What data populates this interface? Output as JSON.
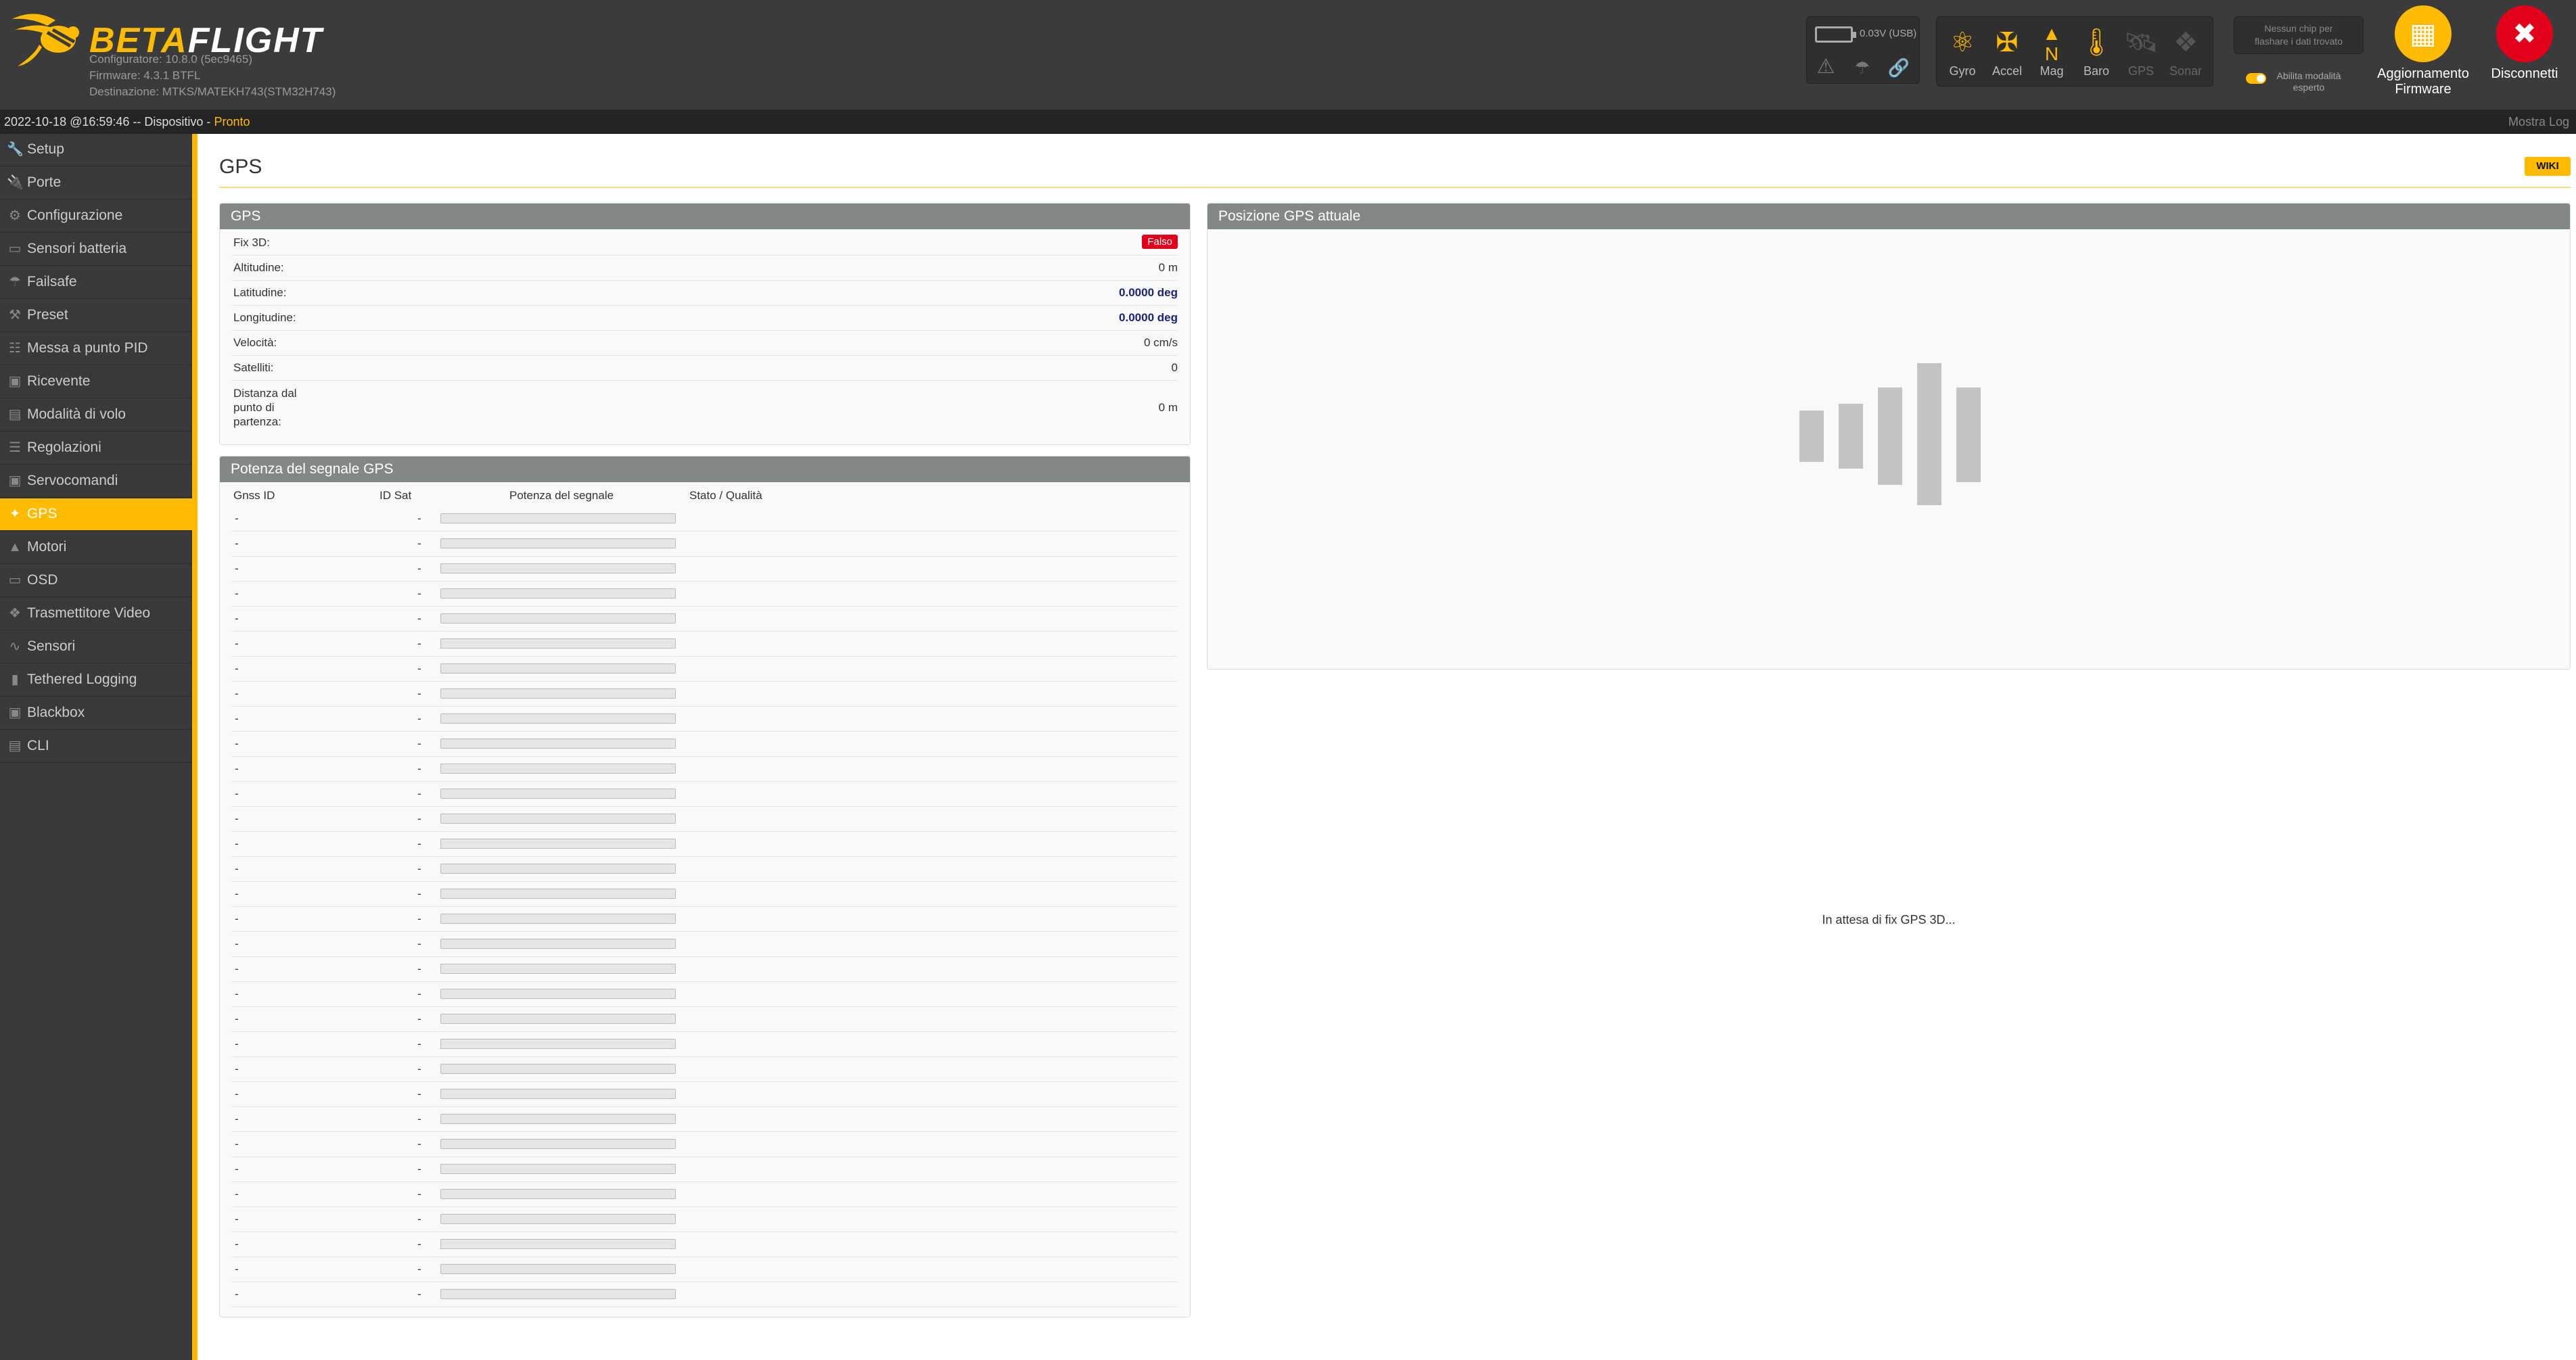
{
  "header": {
    "brand_a": "BETA",
    "brand_b": "FLIGHT",
    "configurator_version": "Configuratore: 10.8.0 (5ec9465)",
    "firmware_version": "Firmware: 4.3.1 BTFL",
    "target": "Destinazione: MTKS/MATEKH743(STM32H743)",
    "battery_text": "0.03V (USB)",
    "sensors": [
      {
        "label": "Gyro",
        "icon": "gyro-icon",
        "active": true
      },
      {
        "label": "Accel",
        "icon": "accel-icon",
        "active": true
      },
      {
        "label": "Mag",
        "icon": "mag-icon",
        "active": true
      },
      {
        "label": "Baro",
        "icon": "baro-icon",
        "active": true
      },
      {
        "label": "GPS",
        "icon": "gps-icon",
        "active": false
      },
      {
        "label": "Sonar",
        "icon": "sonar-icon",
        "active": false
      }
    ],
    "chip_text_line1": "Nessun chip per",
    "chip_text_line2": "flashare i dati trovato",
    "expert_mode_line1": "Abilita modalità",
    "expert_mode_line2": "esperto",
    "firmware_button_line1": "Aggiornamento",
    "firmware_button_line2": "Firmware",
    "disconnect_button": "Disconnetti",
    "accent_color": "#ffbb00",
    "disconnect_color": "#e2001a"
  },
  "statusbar": {
    "prefix": "2022-10-18 @16:59:46 -- Dispositivo - ",
    "ready": "Pronto",
    "show_log": "Mostra Log"
  },
  "sidebar": {
    "items": [
      {
        "label": "Setup",
        "icon": "wrench-icon"
      },
      {
        "label": "Porte",
        "icon": "plug-icon"
      },
      {
        "label": "Configurazione",
        "icon": "gear-icon"
      },
      {
        "label": "Sensori batteria",
        "icon": "battery-icon"
      },
      {
        "label": "Failsafe",
        "icon": "parachute-icon"
      },
      {
        "label": "Preset",
        "icon": "preset-icon"
      },
      {
        "label": "Messa a punto PID",
        "icon": "pid-icon"
      },
      {
        "label": "Ricevente",
        "icon": "receiver-icon"
      },
      {
        "label": "Modalità di volo",
        "icon": "modes-icon"
      },
      {
        "label": "Regolazioni",
        "icon": "adjustments-icon"
      },
      {
        "label": "Servocomandi",
        "icon": "servo-icon"
      },
      {
        "label": "GPS",
        "icon": "gps-icon",
        "active": true
      },
      {
        "label": "Motori",
        "icon": "motor-icon"
      },
      {
        "label": "OSD",
        "icon": "osd-icon"
      },
      {
        "label": "Trasmettitore Video",
        "icon": "vtx-icon"
      },
      {
        "label": "Sensori",
        "icon": "sensors-icon"
      },
      {
        "label": "Tethered Logging",
        "icon": "logging-icon"
      },
      {
        "label": "Blackbox",
        "icon": "blackbox-icon"
      },
      {
        "label": "CLI",
        "icon": "cli-icon"
      }
    ]
  },
  "main": {
    "title": "GPS",
    "wiki": "WIKI",
    "gps_box": {
      "title": "GPS",
      "rows": [
        {
          "label": "Fix 3D:",
          "value": "Falso"
        },
        {
          "label": "Altitudine:",
          "value": "0 m"
        },
        {
          "label": "Latitudine:",
          "value": "0.0000 deg"
        },
        {
          "label": "Longitudine:",
          "value": "0.0000 deg"
        },
        {
          "label": "Velocità:",
          "value": "0 cm/s"
        },
        {
          "label": "Satelliti:",
          "value": "0"
        },
        {
          "label": "Distanza dal punto di partenza:",
          "value": "0 m"
        }
      ]
    },
    "signal_box": {
      "title": "Potenza del segnale GPS",
      "headers": [
        "Gnss ID",
        "ID Sat",
        "Potenza del segnale",
        "Stato / Qualità"
      ],
      "rows": [
        {
          "gnss_id": "-",
          "sat_id": "-",
          "strength": 0
        },
        {
          "gnss_id": "-",
          "sat_id": "-",
          "strength": 0
        },
        {
          "gnss_id": "-",
          "sat_id": "-",
          "strength": 0
        },
        {
          "gnss_id": "-",
          "sat_id": "-",
          "strength": 0
        },
        {
          "gnss_id": "-",
          "sat_id": "-",
          "strength": 0
        },
        {
          "gnss_id": "-",
          "sat_id": "-",
          "strength": 0
        },
        {
          "gnss_id": "-",
          "sat_id": "-",
          "strength": 0
        },
        {
          "gnss_id": "-",
          "sat_id": "-",
          "strength": 0
        },
        {
          "gnss_id": "-",
          "sat_id": "-",
          "strength": 0
        },
        {
          "gnss_id": "-",
          "sat_id": "-",
          "strength": 0
        },
        {
          "gnss_id": "-",
          "sat_id": "-",
          "strength": 0
        },
        {
          "gnss_id": "-",
          "sat_id": "-",
          "strength": 0
        },
        {
          "gnss_id": "-",
          "sat_id": "-",
          "strength": 0
        },
        {
          "gnss_id": "-",
          "sat_id": "-",
          "strength": 0
        },
        {
          "gnss_id": "-",
          "sat_id": "-",
          "strength": 0
        },
        {
          "gnss_id": "-",
          "sat_id": "-",
          "strength": 0
        },
        {
          "gnss_id": "-",
          "sat_id": "-",
          "strength": 0
        },
        {
          "gnss_id": "-",
          "sat_id": "-",
          "strength": 0
        },
        {
          "gnss_id": "-",
          "sat_id": "-",
          "strength": 0
        },
        {
          "gnss_id": "-",
          "sat_id": "-",
          "strength": 0
        },
        {
          "gnss_id": "-",
          "sat_id": "-",
          "strength": 0
        },
        {
          "gnss_id": "-",
          "sat_id": "-",
          "strength": 0
        },
        {
          "gnss_id": "-",
          "sat_id": "-",
          "strength": 0
        },
        {
          "gnss_id": "-",
          "sat_id": "-",
          "strength": 0
        },
        {
          "gnss_id": "-",
          "sat_id": "-",
          "strength": 0
        },
        {
          "gnss_id": "-",
          "sat_id": "-",
          "strength": 0
        },
        {
          "gnss_id": "-",
          "sat_id": "-",
          "strength": 0
        },
        {
          "gnss_id": "-",
          "sat_id": "-",
          "strength": 0
        },
        {
          "gnss_id": "-",
          "sat_id": "-",
          "strength": 0
        },
        {
          "gnss_id": "-",
          "sat_id": "-",
          "strength": 0
        },
        {
          "gnss_id": "-",
          "sat_id": "-",
          "strength": 0
        },
        {
          "gnss_id": "-",
          "sat_id": "-",
          "strength": 0
        }
      ]
    },
    "position_box": {
      "title": "Posizione GPS attuale",
      "waiting": "In attesa di fix GPS 3D..."
    }
  }
}
